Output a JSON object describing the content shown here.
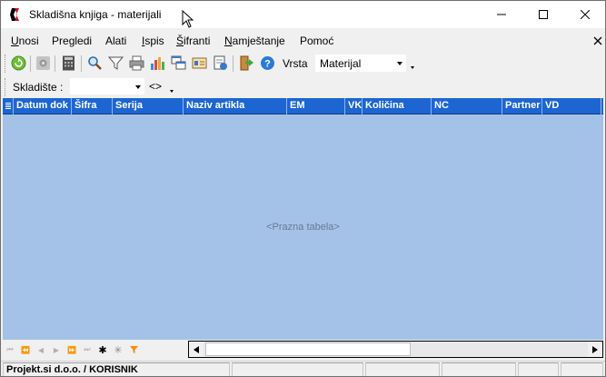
{
  "window": {
    "title": "Skladišna knjiga - materijali"
  },
  "menu": {
    "items": [
      {
        "pre": "",
        "u": "U",
        "post": "nosi"
      },
      {
        "pre": "Pre",
        "u": "g",
        "post": "ledi"
      },
      {
        "pre": "Alati",
        "u": "",
        "post": ""
      },
      {
        "pre": "",
        "u": "I",
        "post": "spis"
      },
      {
        "pre": "",
        "u": "Š",
        "post": "ifranti"
      },
      {
        "pre": "",
        "u": "N",
        "post": "amještanje"
      },
      {
        "pre": "Pomoć",
        "u": "",
        "post": ""
      }
    ]
  },
  "toolbar": {
    "vrsta_label": "Vrsta",
    "vrsta_value": "Materijal"
  },
  "filter": {
    "skladiste_label": "Skladište :",
    "skladiste_value": "",
    "nav_arrows": "<>"
  },
  "grid": {
    "columns": [
      "Datum dok",
      "Šifra",
      "Serija",
      "Naziv artikla",
      "EM",
      "VK",
      "Količina",
      "NC",
      "Partner",
      "VD"
    ],
    "empty_message": "<Prazna tabela>"
  },
  "status": {
    "panels": [
      "Projekt.si d.o.o. / KORISNIK",
      "",
      "",
      "",
      "",
      ""
    ]
  },
  "colors": {
    "grid_header": "#1d66d2",
    "grid_body": "#a4c2e8"
  }
}
